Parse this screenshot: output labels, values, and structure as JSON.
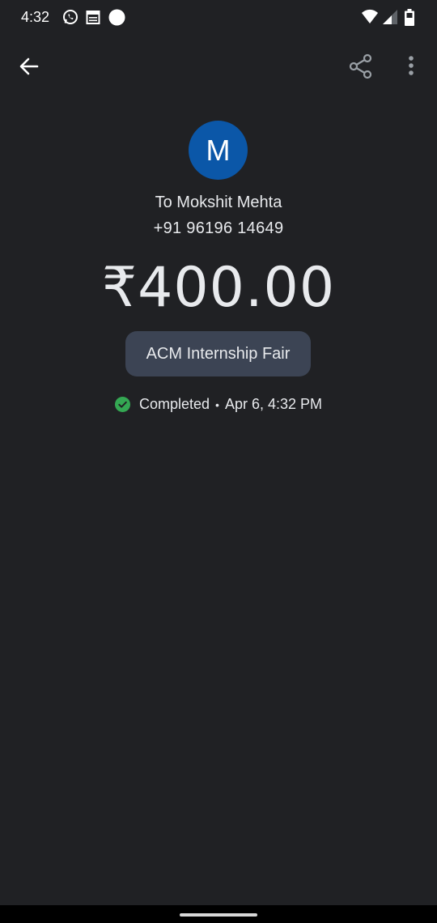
{
  "status_bar": {
    "time": "4:32",
    "icons": [
      "whatsapp-icon",
      "calendar-icon",
      "dot-icon",
      "wifi-icon",
      "signal-icon",
      "battery-icon"
    ]
  },
  "app_bar": {
    "icons": [
      "back-arrow-icon",
      "share-icon",
      "more-vert-icon"
    ]
  },
  "transaction": {
    "avatar_letter": "M",
    "recipient": "To Mokshit Mehta",
    "phone": "+91 96196 14649",
    "amount": "₹400.00",
    "note": "ACM Internship Fair",
    "status": "Completed",
    "separator": "•",
    "datetime": "Apr 6, 4:32 PM"
  },
  "colors": {
    "background": "#202124",
    "avatar": "#0b57a8",
    "chip": "#3c4454",
    "success": "#34a853"
  }
}
